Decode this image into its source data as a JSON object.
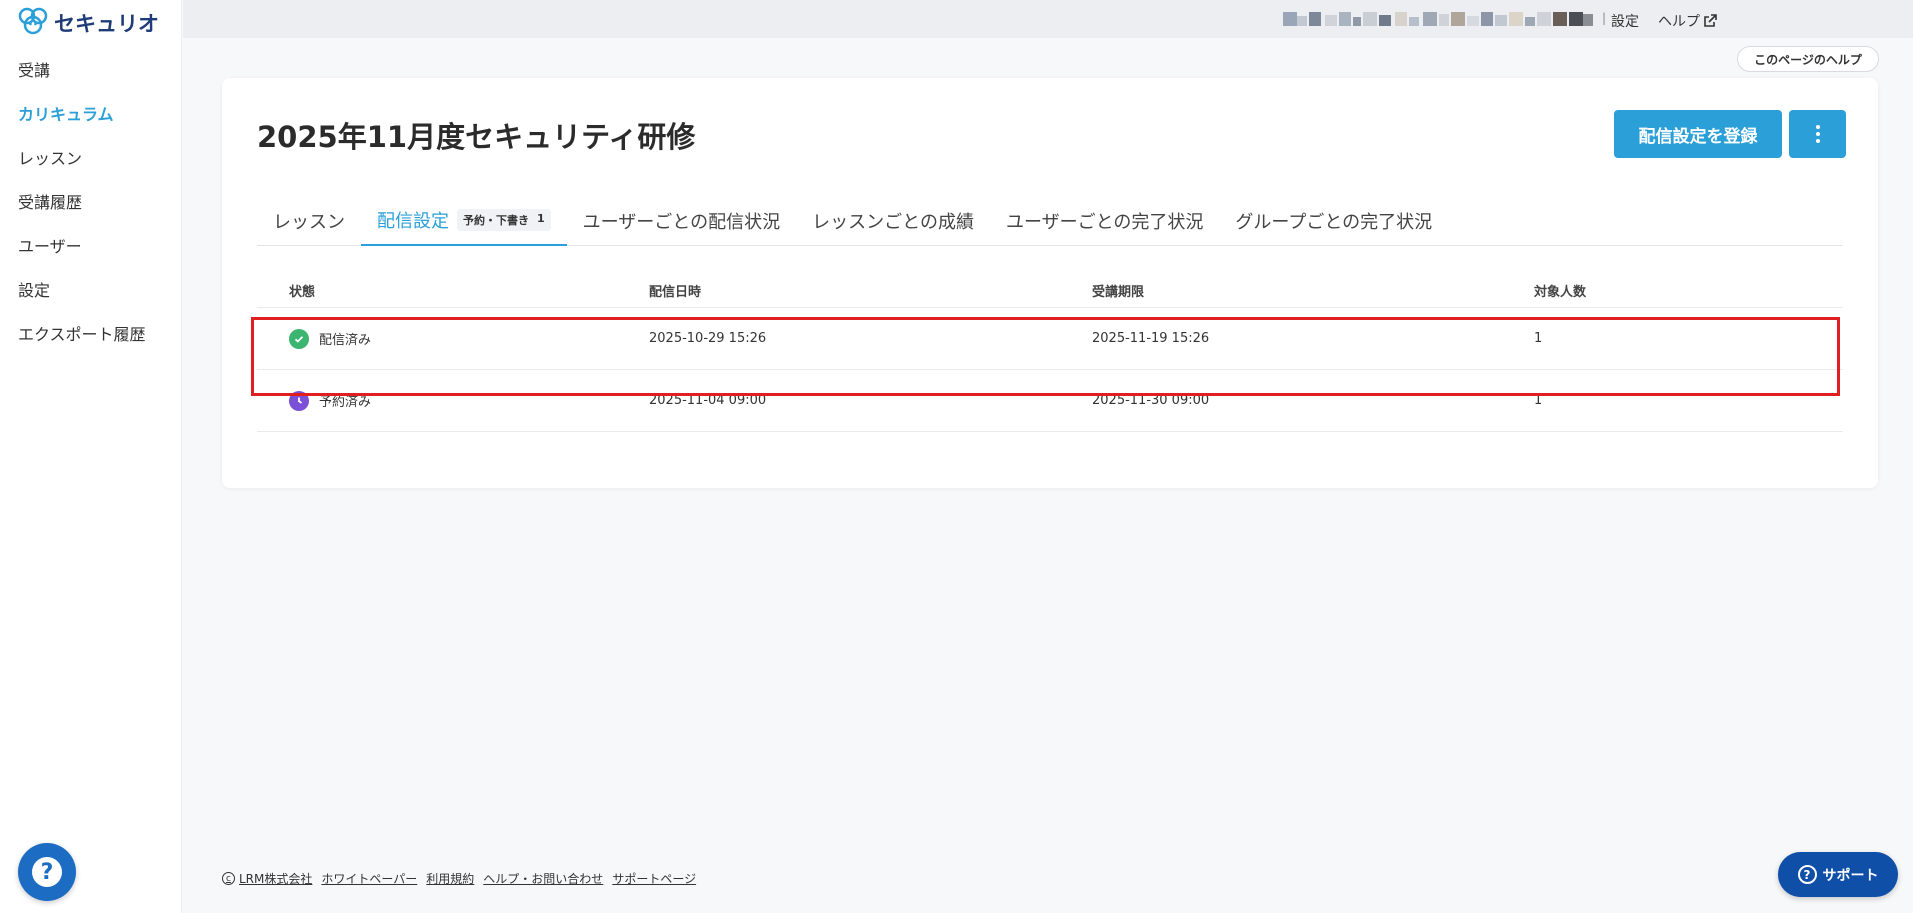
{
  "app": {
    "logo_text": "セキュリオ"
  },
  "sidebar": {
    "items": [
      {
        "label": "受講"
      },
      {
        "label": "カリキュラム"
      },
      {
        "label": "レッスン"
      },
      {
        "label": "受講履歴"
      },
      {
        "label": "ユーザー"
      },
      {
        "label": "設定"
      },
      {
        "label": "エクスポート履歴"
      }
    ],
    "active_index": 1,
    "help_glyph": "?"
  },
  "topbar": {
    "separator": "|",
    "settings_label": "設定",
    "help_label": "ヘルプ"
  },
  "page_help_label": "このページのヘルプ",
  "page": {
    "title": "2025年11月度セキュリティ研修",
    "primary_action": "配信設定を登録"
  },
  "tabs": [
    {
      "label": "レッスン"
    },
    {
      "label": "配信設定",
      "badge_label": "予約・下書き",
      "badge_count": "1"
    },
    {
      "label": "ユーザーごとの配信状況"
    },
    {
      "label": "レッスンごとの成績"
    },
    {
      "label": "ユーザーごとの完了状況"
    },
    {
      "label": "グループごとの完了状況"
    }
  ],
  "table": {
    "headers": [
      "状態",
      "配信日時",
      "受講期限",
      "対象人数"
    ],
    "rows": [
      {
        "status": "配信済み",
        "status_type": "delivered",
        "delivered_at": "2025-10-29 15:26",
        "deadline": "2025-11-19 15:26",
        "count": "1"
      },
      {
        "status": "予約済み",
        "status_type": "scheduled",
        "delivered_at": "2025-11-04 09:00",
        "deadline": "2025-11-30 09:00",
        "count": "1"
      }
    ]
  },
  "footer": {
    "company": "LRM株式会社",
    "links": [
      "ホワイトペーパー",
      "利用規約",
      "ヘルプ・お問い合わせ",
      "サポートページ"
    ]
  },
  "support_button": {
    "label": "サポート",
    "glyph": "?"
  },
  "colors": {
    "accent": "#2a9fd8",
    "delivered": "#3bb56f",
    "scheduled": "#7b4fd6",
    "highlight": "#e02020",
    "support": "#0f4fa8"
  }
}
